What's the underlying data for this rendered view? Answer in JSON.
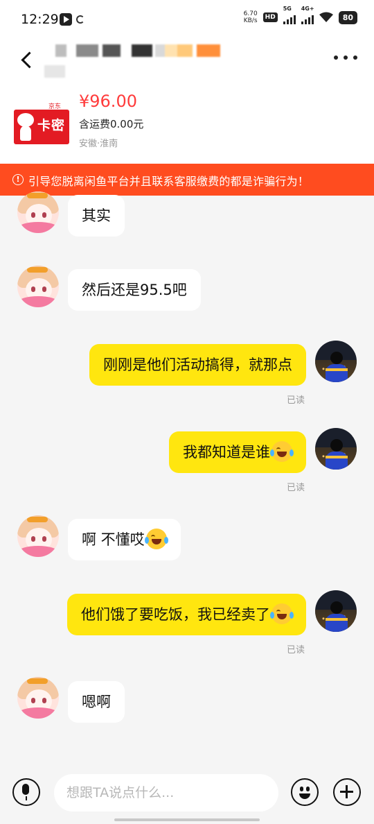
{
  "status_bar": {
    "time": "12:29",
    "speed_top": "6.70",
    "speed_bottom": "KB/s",
    "hd_label": "HD",
    "net1": "5G",
    "net2": "4G+",
    "battery": "80"
  },
  "header": {
    "back_icon": "back-icon",
    "more_icon": "more-icon"
  },
  "product": {
    "card_label": "卡密",
    "brand_tag": "京东",
    "price": "¥96.00",
    "shipping": "含运费0.00元",
    "location": "安徽·淮南"
  },
  "warning": {
    "icon": "!",
    "text": "引导您脱离闲鱼平台并且联系客服缴费的都是诈骗行为！"
  },
  "messages": [
    {
      "side": "left",
      "text": "其实"
    },
    {
      "side": "left",
      "text": "然后还是95.5吧"
    },
    {
      "side": "right",
      "text": "刚刚是他们活动搞得，就那点",
      "status": "已读"
    },
    {
      "side": "right",
      "text": "我都知道是谁",
      "emoji": "laugh-cry",
      "status": "已读"
    },
    {
      "side": "left",
      "text": "啊 不懂哎",
      "emoji": "laugh-cry"
    },
    {
      "side": "right",
      "text": "他们饿了要吃饭，我已经卖了",
      "emoji": "laugh-cry",
      "status": "已读"
    },
    {
      "side": "left",
      "text": "嗯啊"
    }
  ],
  "input": {
    "placeholder": "想跟TA说点什么..."
  },
  "colors": {
    "bubble_right": "#ffe60f",
    "warning_bg": "#ff4c1f",
    "price": "#ff3b3b"
  }
}
